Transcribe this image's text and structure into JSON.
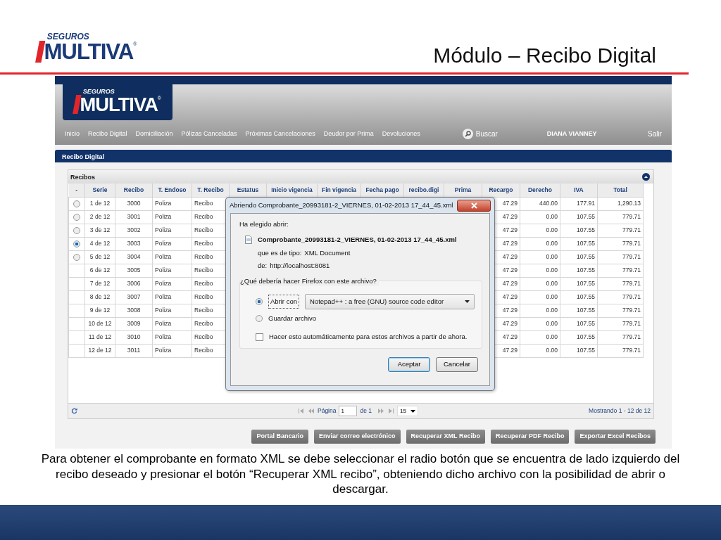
{
  "slide": {
    "logo": {
      "small": "SEGUROS",
      "big": "MULTIVA",
      "mark": "®"
    },
    "title": "Módulo – Recibo Digital",
    "caption": "Para obtener el comprobante en formato XML se debe seleccionar el radio botón que se encuentra de lado izquierdo del recibo deseado y presionar el botón “Recuperar XML recibo”, obteniendo dicho archivo con la posibilidad de abrir o descargar."
  },
  "app": {
    "logo": {
      "small": "SEGUROS",
      "big": "MULTIVA",
      "mark": "®"
    },
    "nav": [
      {
        "label": "Inicio"
      },
      {
        "label": "Recibo Digital"
      },
      {
        "label": "Domiciliación"
      },
      {
        "label": "Pólizas Canceladas"
      },
      {
        "label": "Próximas Cancelaciones"
      },
      {
        "label": "Deudor por Prima"
      },
      {
        "label": "Devoluciones"
      }
    ],
    "search": "Buscar",
    "user": "DIANA VIANNEY",
    "logout": "Salir",
    "panel_title": "Recibo Digital",
    "grid": {
      "title": "Recibos",
      "columns": [
        "-",
        "Serie",
        "Recibo",
        "T. Endoso",
        "T. Recibo",
        "Estatus",
        "Inicio vigencia",
        "Fin vigencia",
        "Fecha pago",
        "recibo.digi",
        "Prima",
        "Recargo",
        "Derecho",
        "IVA",
        "Total"
      ],
      "rows": [
        {
          "kind": "radio",
          "selected": false,
          "serie": "1 de 12",
          "recibo": "3000",
          "t_endoso": "Poliza",
          "t_recibo": "Recibo",
          "recargo": "47.29",
          "derecho": "440.00",
          "iva": "177.91",
          "total": "1,290.13"
        },
        {
          "kind": "radio",
          "selected": false,
          "serie": "2 de 12",
          "recibo": "3001",
          "t_endoso": "Poliza",
          "t_recibo": "Recibo",
          "recargo": "47.29",
          "derecho": "0.00",
          "iva": "107.55",
          "total": "779.71"
        },
        {
          "kind": "radio",
          "selected": false,
          "serie": "3 de 12",
          "recibo": "3002",
          "t_endoso": "Poliza",
          "t_recibo": "Recibo",
          "recargo": "47.29",
          "derecho": "0.00",
          "iva": "107.55",
          "total": "779.71"
        },
        {
          "kind": "radio",
          "selected": true,
          "serie": "4 de 12",
          "recibo": "3003",
          "t_endoso": "Poliza",
          "t_recibo": "Recibo",
          "recargo": "47.29",
          "derecho": "0.00",
          "iva": "107.55",
          "total": "779.71"
        },
        {
          "kind": "radio",
          "selected": false,
          "serie": "5 de 12",
          "recibo": "3004",
          "t_endoso": "Poliza",
          "t_recibo": "Recibo",
          "recargo": "47.29",
          "derecho": "0.00",
          "iva": "107.55",
          "total": "779.71"
        },
        {
          "kind": "plain",
          "selected": false,
          "serie": "6 de 12",
          "recibo": "3005",
          "t_endoso": "Poliza",
          "t_recibo": "Recibo",
          "recargo": "47.29",
          "derecho": "0.00",
          "iva": "107.55",
          "total": "779.71"
        },
        {
          "kind": "plain",
          "selected": false,
          "serie": "7 de 12",
          "recibo": "3006",
          "t_endoso": "Poliza",
          "t_recibo": "Recibo",
          "recargo": "47.29",
          "derecho": "0.00",
          "iva": "107.55",
          "total": "779.71"
        },
        {
          "kind": "plain",
          "selected": false,
          "serie": "8 de 12",
          "recibo": "3007",
          "t_endoso": "Poliza",
          "t_recibo": "Recibo",
          "recargo": "47.29",
          "derecho": "0.00",
          "iva": "107.55",
          "total": "779.71"
        },
        {
          "kind": "plain",
          "selected": false,
          "serie": "9 de 12",
          "recibo": "3008",
          "t_endoso": "Poliza",
          "t_recibo": "Recibo",
          "recargo": "47.29",
          "derecho": "0.00",
          "iva": "107.55",
          "total": "779.71"
        },
        {
          "kind": "plain",
          "selected": false,
          "serie": "10 de 12",
          "recibo": "3009",
          "t_endoso": "Poliza",
          "t_recibo": "Recibo",
          "recargo": "47.29",
          "derecho": "0.00",
          "iva": "107.55",
          "total": "779.71"
        },
        {
          "kind": "plain",
          "selected": false,
          "serie": "11 de 12",
          "recibo": "3010",
          "t_endoso": "Poliza",
          "t_recibo": "Recibo",
          "recargo": "47.29",
          "derecho": "0.00",
          "iva": "107.55",
          "total": "779.71"
        },
        {
          "kind": "plain",
          "selected": false,
          "serie": "12 de 12",
          "recibo": "3011",
          "t_endoso": "Poliza",
          "t_recibo": "Recibo",
          "recargo": "47.29",
          "derecho": "0.00",
          "iva": "107.55",
          "total": "779.71"
        }
      ],
      "pager": {
        "page_label": "Página",
        "page": "1",
        "of": "de 1",
        "page_size": "15",
        "summary": "Mostrando 1 - 12 de 12"
      }
    },
    "buttons": [
      "Portal Bancario",
      "Enviar correo electrónico",
      "Recuperar XML Recibo",
      "Recuperar PDF Recibo",
      "Exportar Excel Recibos"
    ],
    "dialog": {
      "title": "Abriendo Comprobante_20993181-2_VIERNES, 01-02-2013 17_44_45.xml",
      "intro": "Ha elegido abrir:",
      "file": "Comprobante_20993181-2_VIERNES, 01-02-2013 17_44_45.xml",
      "type_label": "que es de tipo:",
      "type": "XML Document",
      "from_label": "de:",
      "from": "http://localhost:8081",
      "question": "¿Qué debería hacer Firefox con este archivo?",
      "options": [
        {
          "label": "Abrir con",
          "selected": true
        },
        {
          "label": "Guardar archivo",
          "selected": false
        }
      ],
      "application": "Notepad++ : a free (GNU) source code editor",
      "auto": {
        "label": "Hacer esto automáticamente para estos archivos a partir de ahora.",
        "checked": false
      },
      "buttons": [
        "Aceptar",
        "Cancelar"
      ]
    }
  }
}
